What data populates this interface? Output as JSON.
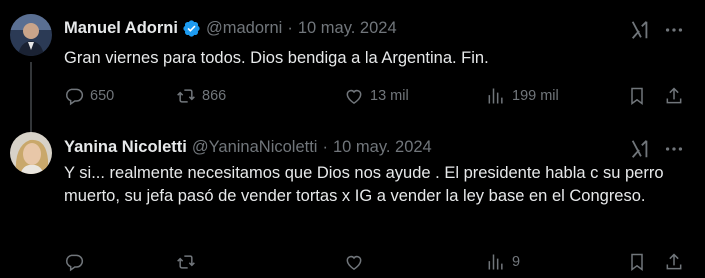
{
  "tweets": [
    {
      "name": "Manuel Adorni",
      "verified": true,
      "handle": "@madorni",
      "separator": "·",
      "date": "10 may. 2024",
      "text": "Gran viernes para todos. Dios bendiga a la Argentina. Fin.",
      "replies": "650",
      "retweets": "866",
      "likes": "13 mil",
      "views": "199 mil"
    },
    {
      "name": "Yanina Nicoletti",
      "verified": false,
      "handle": "@YaninaNicoletti",
      "separator": "·",
      "date": "10 may. 2024",
      "text": "Y si... realmente necesitamos que Dios nos ayude . El presidente habla  c su perro muerto, su jefa pasó de vender tortas x IG a vender la ley base en el Congreso.",
      "replies": "",
      "retweets": "",
      "likes": "",
      "views": "9"
    }
  ],
  "colors": {
    "background": "#000000",
    "text": "#e7e9ea",
    "muted": "#71767b",
    "verified": "#1d9bf0",
    "thread_line": "#333639"
  },
  "icons": [
    "verified-badge-icon",
    "grok-icon",
    "more-icon",
    "reply-icon",
    "retweet-icon",
    "like-icon",
    "views-icon",
    "bookmark-icon",
    "share-icon"
  ]
}
